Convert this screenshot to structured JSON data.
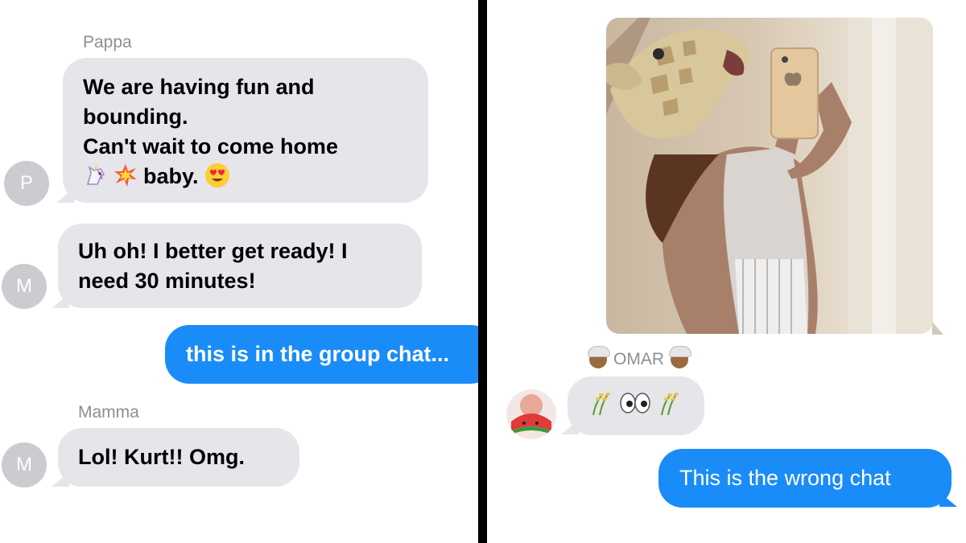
{
  "left": {
    "messages": [
      {
        "sender": "Pappa",
        "avatar": "P",
        "lines": [
          "We are having fun and",
          "bounding.",
          "Can't wait to come home"
        ],
        "last_line_text": "baby.",
        "emojis": [
          "unicorn",
          "collision",
          "heart-eyes"
        ]
      },
      {
        "avatar": "M",
        "lines": [
          "Uh oh!  I better get ready!  I",
          "need 30 minutes!"
        ]
      },
      {
        "outgoing": true,
        "text": "this is in the group chat..."
      },
      {
        "sender": "Mamma",
        "avatar": "M",
        "text": "Lol!  Kurt!!  Omg."
      }
    ]
  },
  "right": {
    "photo": {
      "description_icon": "mirror-selfie-giraffe-mask"
    },
    "sender_label": "OMAR",
    "sender_emoji": "person-with-turban",
    "incoming_emojis": [
      "rice-plant",
      "eyes",
      "rice-plant"
    ],
    "outgoing_text": "This is the wrong chat"
  },
  "colors": {
    "incoming": "#e5e5ea",
    "outgoing": "#1a8cf7",
    "meta": "#8e8e93",
    "divider": "#000000"
  }
}
